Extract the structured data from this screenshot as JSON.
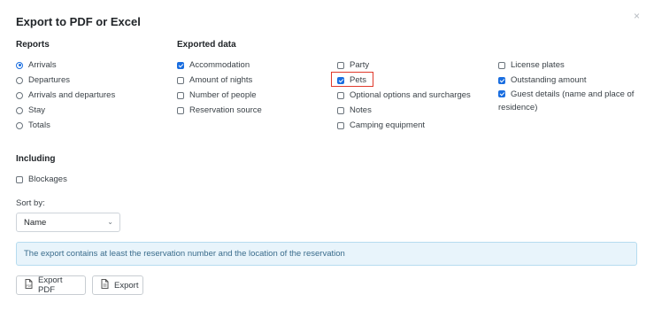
{
  "dialog": {
    "title": "Export to PDF or Excel",
    "close_icon": "×"
  },
  "reports": {
    "heading": "Reports",
    "options": [
      {
        "label": "Arrivals",
        "checked": true
      },
      {
        "label": "Departures",
        "checked": false
      },
      {
        "label": "Arrivals and departures",
        "checked": false
      },
      {
        "label": "Stay",
        "checked": false
      },
      {
        "label": "Totals",
        "checked": false
      }
    ]
  },
  "exported_data": {
    "heading": "Exported data",
    "col1": [
      {
        "label": "Accommodation",
        "checked": true
      },
      {
        "label": "Amount of nights",
        "checked": false
      },
      {
        "label": "Number of people",
        "checked": false
      },
      {
        "label": "Reservation source",
        "checked": false
      }
    ],
    "col2": [
      {
        "label": "Party",
        "checked": false
      },
      {
        "label": "Pets",
        "checked": true
      },
      {
        "label": "Optional options and surcharges",
        "checked": false
      },
      {
        "label": "Notes",
        "checked": false
      },
      {
        "label": "Camping equipment",
        "checked": false
      }
    ],
    "col3": [
      {
        "label": "License plates",
        "checked": false
      },
      {
        "label": "Outstanding amount",
        "checked": true
      },
      {
        "label": "Guest details (name and place of residence)",
        "checked": true
      }
    ]
  },
  "including": {
    "heading": "Including",
    "blockages_label": "Blockages",
    "blockages_checked": false
  },
  "sort": {
    "label": "Sort by:",
    "selected": "Name"
  },
  "info_text": "The export contains at least the reservation number and the location of the reservation",
  "buttons": {
    "export_pdf": "Export PDF",
    "export": "Export"
  },
  "colors": {
    "accent": "#1a6ee0",
    "highlight": "#e0392b",
    "info_bg": "#e8f4fb"
  }
}
